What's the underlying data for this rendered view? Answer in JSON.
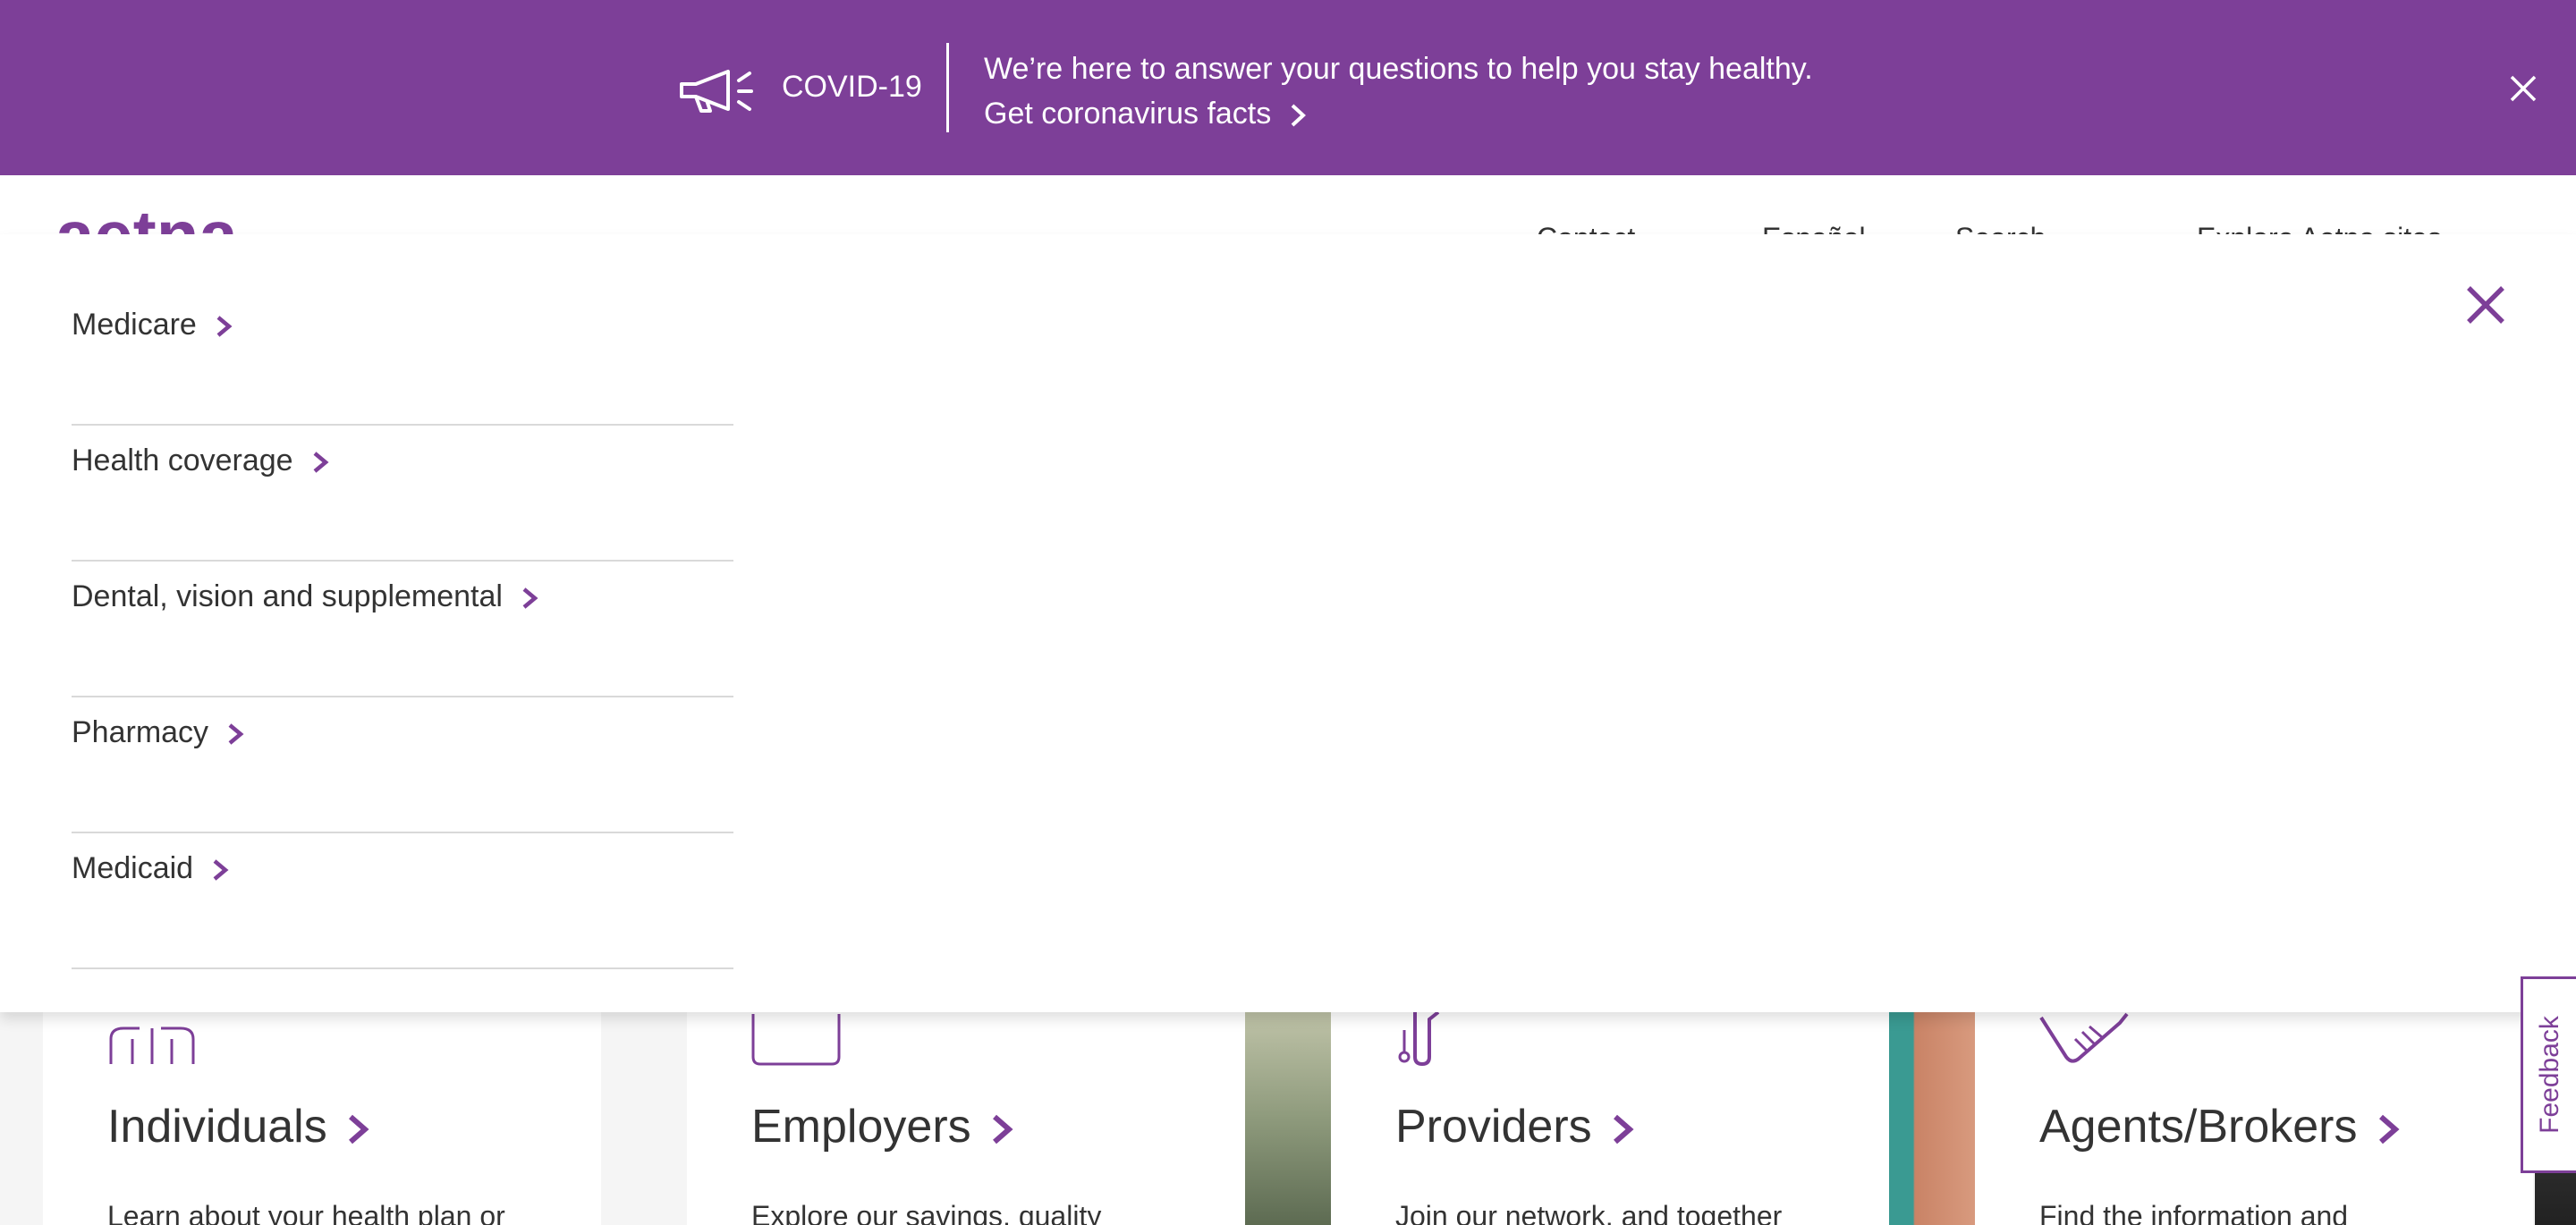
{
  "banner": {
    "covid_label": "COVID-19",
    "message": "We’re here to answer your questions to help you stay healthy.",
    "facts_link": "Get coronavirus facts",
    "background": "#7d3f98"
  },
  "header": {
    "logo_text": "aetna",
    "nav": [
      "Contact",
      "Español",
      "Search",
      "Explore Aetna sites"
    ]
  },
  "menu": {
    "items": [
      {
        "label": "Medicare"
      },
      {
        "label": "Health coverage"
      },
      {
        "label": "Dental, vision and supplemental"
      },
      {
        "label": "Pharmacy"
      },
      {
        "label": "Medicaid"
      }
    ]
  },
  "cards": [
    {
      "title": "Individuals",
      "desc": "Learn about your health plan or",
      "icon": "individuals-icon"
    },
    {
      "title": "Employers",
      "desc": "Explore our savings, quality",
      "icon": "employers-icon"
    },
    {
      "title": "Providers",
      "desc": "Join our network, and together",
      "icon": "stethoscope-icon"
    },
    {
      "title": "Agents/Brokers",
      "desc": "Find the information and",
      "icon": "handshake-icon"
    }
  ],
  "feedback_label": "Feedback",
  "colors": {
    "accent": "#7d3f98",
    "text": "#333333",
    "divider": "#d9d9d9"
  }
}
